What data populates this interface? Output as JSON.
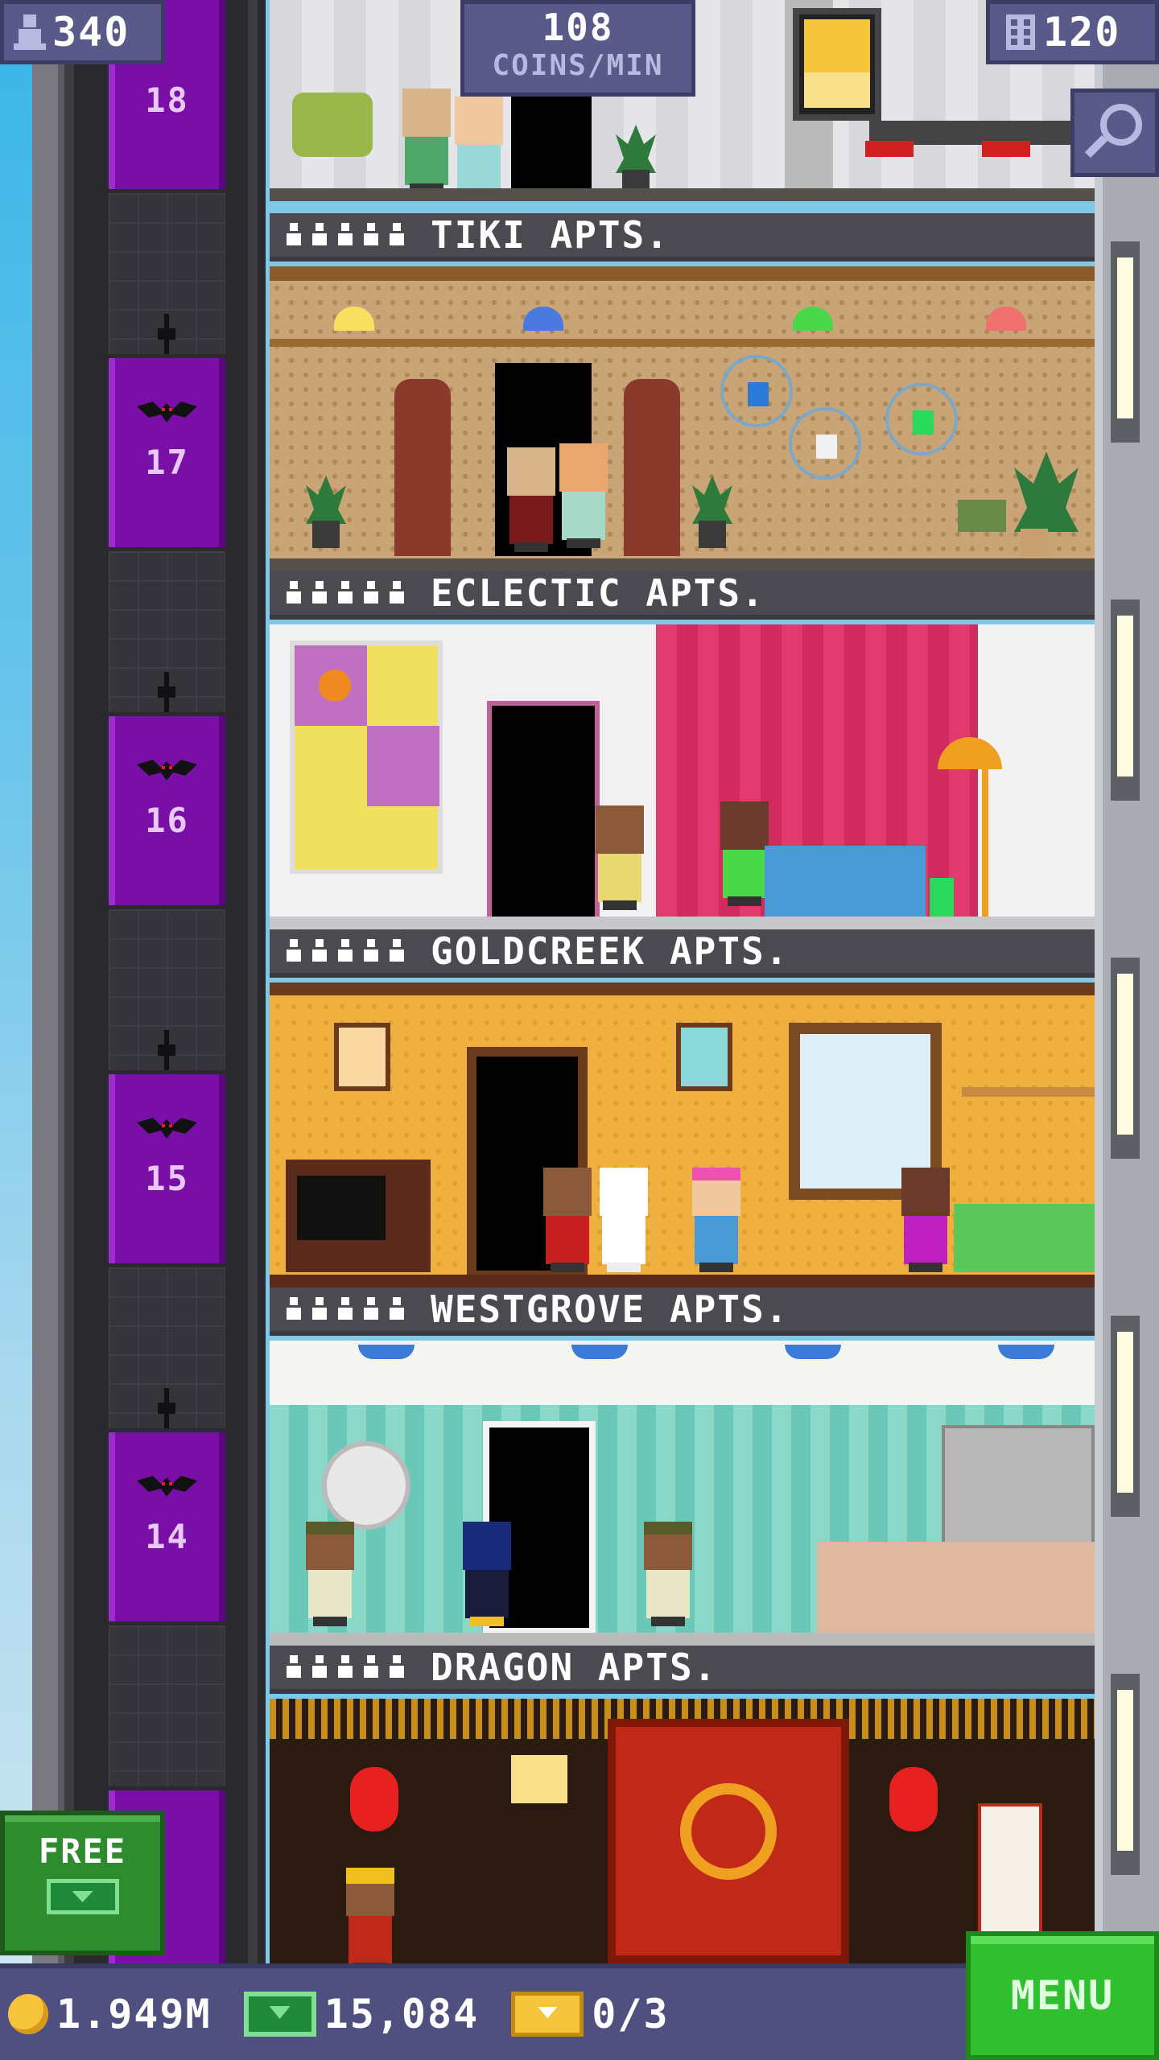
{
  "hud": {
    "population": "340",
    "coins_rate_value": "108",
    "coins_rate_unit": "COINS/MIN",
    "floor_count": "120"
  },
  "elevator_floors": [
    "18",
    "17",
    "16",
    "15",
    "14"
  ],
  "floors": [
    {
      "name": "TIKI APTS."
    },
    {
      "name": "ECLECTIC APTS."
    },
    {
      "name": "GOLDCREEK APTS."
    },
    {
      "name": "WESTGROVE APTS."
    },
    {
      "name": "DRAGON APTS."
    }
  ],
  "free_button": {
    "label": "FREE"
  },
  "bottom_bar": {
    "coins": "1.949M",
    "bux": "15,084",
    "tickets": "0/3",
    "menu_label": "MENU"
  },
  "colors": {
    "elevator_purple": "#7a0fa8",
    "hud_panel": "#5a5a8a",
    "menu_green": "#2fbf2f"
  },
  "icons": [
    "person-icon",
    "coin-icon",
    "bux-icon",
    "ticket-icon",
    "search-icon",
    "bat-icon",
    "floors-icon"
  ]
}
